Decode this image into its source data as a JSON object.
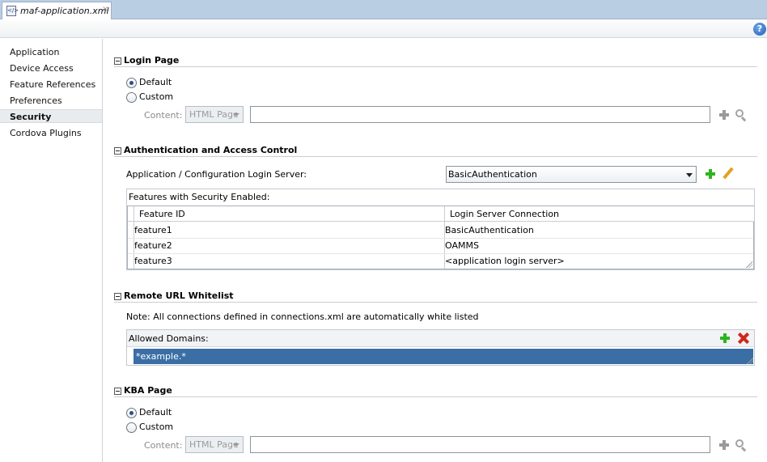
{
  "tab": {
    "title": "maf-application.xml",
    "close": "×"
  },
  "help": {
    "label": "?"
  },
  "sidebar": {
    "items": [
      {
        "label": "Application"
      },
      {
        "label": "Device Access"
      },
      {
        "label": "Feature References"
      },
      {
        "label": "Preferences"
      },
      {
        "label": "Security"
      },
      {
        "label": "Cordova Plugins"
      }
    ],
    "selected": "Security"
  },
  "login_page": {
    "title": "Login Page",
    "default_label": "Default",
    "custom_label": "Custom",
    "selected": "Default",
    "content_label": "Content:",
    "content_type": "HTML Page",
    "content_value": ""
  },
  "auth": {
    "title": "Authentication and Access Control",
    "server_label": "Application / Configuration Login Server:",
    "server_value": "BasicAuthentication",
    "features_caption": "Features with Security Enabled:",
    "columns": [
      "Feature ID",
      "Login Server Connection"
    ],
    "rows": [
      {
        "feature_id": "feature1",
        "connection": "BasicAuthentication"
      },
      {
        "feature_id": "feature2",
        "connection": "OAMMS"
      },
      {
        "feature_id": "feature3",
        "connection": "<application login server>"
      }
    ]
  },
  "whitelist": {
    "title": "Remote URL Whitelist",
    "note": "Note: All connections defined in connections.xml are automatically white listed",
    "caption": "Allowed Domains:",
    "domains": [
      "*example.*"
    ]
  },
  "kba_page": {
    "title": "KBA Page",
    "default_label": "Default",
    "custom_label": "Custom",
    "selected": "Default",
    "content_label": "Content:",
    "content_type": "HTML Page",
    "content_value": ""
  },
  "colors": {
    "accent_selection": "#3a6ea5",
    "add_green": "#2bb51e",
    "delete_red": "#d0271b",
    "tab_bar": "#b9cde3"
  }
}
